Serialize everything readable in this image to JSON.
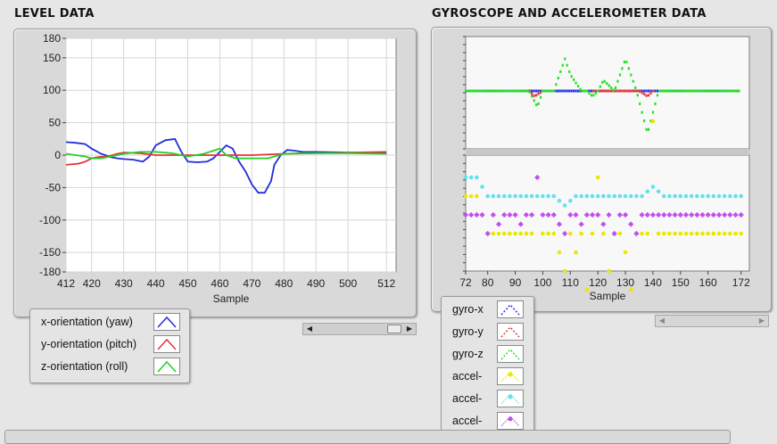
{
  "titles": {
    "level": "LEVEL DATA",
    "gyro": "GYROSCOPE AND ACCELEROMETER DATA"
  },
  "chart_data": [
    {
      "type": "line",
      "xlabel": "Sample",
      "xlim": [
        412,
        515
      ],
      "ylim": [
        -180,
        180
      ],
      "xticks": [
        412,
        420,
        430,
        440,
        450,
        460,
        470,
        480,
        490,
        500,
        512
      ],
      "yticks": [
        180,
        150,
        100,
        50,
        0,
        -50,
        -100,
        -150,
        -180
      ],
      "grid": true,
      "series": [
        {
          "name": "x-orientation (yaw)",
          "color": "#1f2fd9",
          "x": [
            412,
            415,
            418,
            420,
            423,
            426,
            428,
            430,
            433,
            436,
            438,
            440,
            443,
            446,
            448,
            450,
            453,
            456,
            458,
            460,
            462,
            464,
            466,
            468,
            470,
            472,
            474,
            476,
            477,
            479,
            481,
            483,
            486,
            490,
            500,
            512
          ],
          "y": [
            20,
            19,
            17,
            10,
            2,
            -3,
            -5,
            -6,
            -7,
            -10,
            -2,
            15,
            23,
            25,
            5,
            -10,
            -11,
            -10,
            -5,
            5,
            15,
            10,
            -10,
            -25,
            -45,
            -58,
            -58,
            -40,
            -15,
            0,
            8,
            7,
            5,
            5,
            4,
            3
          ]
        },
        {
          "name": "y-orientation (pitch)",
          "color": "#e8323a",
          "x": [
            412,
            416,
            418,
            420,
            422,
            425,
            428,
            430,
            435,
            440,
            450,
            460,
            470,
            480,
            490,
            500,
            512
          ],
          "y": [
            -15,
            -13,
            -10,
            -5,
            -3,
            -2,
            2,
            4,
            3,
            0,
            0,
            0,
            0,
            2,
            3,
            4,
            5
          ]
        },
        {
          "name": "z-orientation (roll)",
          "color": "#22d022",
          "x": [
            412,
            415,
            418,
            420,
            423,
            426,
            428,
            430,
            435,
            440,
            445,
            450,
            455,
            460,
            462,
            465,
            470,
            475,
            480,
            485,
            490,
            500,
            512
          ],
          "y": [
            2,
            0,
            -2,
            -5,
            -5,
            -2,
            0,
            2,
            5,
            5,
            3,
            -2,
            2,
            10,
            0,
            -5,
            -5,
            -5,
            2,
            3,
            3,
            3,
            2
          ]
        }
      ],
      "legend": [
        {
          "label": "x-orientation (yaw)",
          "color": "#1f2fd9"
        },
        {
          "label": "y-orientation (pitch)",
          "color": "#e8323a"
        },
        {
          "label": "z-orientation (roll)",
          "color": "#22d022"
        }
      ]
    },
    {
      "type": "scatter",
      "xlabel": "Sample",
      "xlim": [
        72,
        175
      ],
      "xticks": [
        72,
        80,
        90,
        100,
        110,
        120,
        130,
        140,
        150,
        160,
        172
      ],
      "grid": true,
      "top_series": [
        {
          "name": "gyro-x",
          "color": "#2233dd",
          "x": [
            72,
            172
          ],
          "y": [
            0,
            0
          ]
        },
        {
          "name": "gyro-y",
          "color": "#e23a3a",
          "x": [
            72,
            95,
            97,
            100,
            110,
            115,
            120,
            125,
            130,
            135,
            138,
            140,
            172
          ],
          "y": [
            0,
            0,
            -1,
            0,
            0,
            0,
            0,
            0,
            0,
            0,
            -1,
            0,
            0
          ]
        },
        {
          "name": "gyro-z",
          "color": "#22e022",
          "x": [
            72,
            95,
            97,
            98,
            100,
            104,
            106,
            108,
            110,
            114,
            116,
            118,
            120,
            122,
            124,
            126,
            128,
            130,
            132,
            134,
            136,
            138,
            140,
            142,
            172
          ],
          "y": [
            0,
            0,
            -2,
            -3,
            0,
            0,
            3,
            6,
            3,
            0,
            0,
            -1,
            0,
            2,
            1,
            0,
            3,
            6,
            3,
            0,
            -4,
            -8,
            -4,
            0,
            0
          ]
        }
      ],
      "bottom_series": [
        {
          "name": "accel-x",
          "color": "#e8e800",
          "x": [
            72,
            76,
            78,
            80,
            82,
            84,
            86,
            88,
            90,
            92,
            94,
            96,
            98,
            100,
            104,
            108,
            110,
            112,
            114,
            116,
            118,
            120,
            122,
            124,
            126,
            128,
            130,
            132,
            134,
            136,
            138,
            140,
            142,
            144,
            172
          ],
          "y": [
            1,
            1,
            0,
            -1,
            -1,
            -1,
            -1,
            -1,
            -1,
            -1,
            -1,
            -1,
            2,
            -1,
            -1,
            -3,
            -1,
            -2,
            -1,
            -4,
            -1,
            2,
            -1,
            -3,
            -1,
            -1,
            -2,
            -4,
            -1,
            -1,
            -1,
            5,
            -1,
            -1,
            -1
          ]
        },
        {
          "name": "accel-y",
          "color": "#66e0ee",
          "x": [
            72,
            76,
            78,
            80,
            82,
            84,
            86,
            88,
            90,
            92,
            94,
            96,
            98,
            100,
            104,
            108,
            112,
            116,
            120,
            124,
            128,
            132,
            136,
            140,
            144,
            172
          ],
          "y": [
            2,
            2,
            1.5,
            1,
            1,
            1,
            1,
            1,
            1,
            1,
            1,
            1,
            1,
            1,
            1,
            0.5,
            1,
            1,
            1,
            1,
            1,
            1,
            1,
            1.5,
            1,
            1
          ]
        },
        {
          "name": "accel-z",
          "color": "#c050ee",
          "x": [
            72,
            76,
            78,
            80,
            82,
            84,
            86,
            88,
            90,
            92,
            94,
            96,
            98,
            100,
            104,
            108,
            110,
            112,
            114,
            116,
            118,
            120,
            122,
            124,
            126,
            128,
            130,
            132,
            134,
            136,
            138,
            140,
            144,
            172
          ],
          "y": [
            0,
            0,
            0,
            -1,
            0,
            -0.5,
            0,
            0,
            0,
            -0.5,
            0,
            0,
            2,
            0,
            0,
            -1,
            0,
            0,
            -0.5,
            0,
            0,
            0,
            -0.5,
            0,
            -1,
            0,
            0,
            -0.5,
            -1,
            0,
            0,
            0,
            0,
            0
          ]
        }
      ],
      "legend": [
        {
          "label": "gyro-x",
          "color": "#2233dd"
        },
        {
          "label": "gyro-y",
          "color": "#e23a3a"
        },
        {
          "label": "gyro-z",
          "color": "#22e022"
        },
        {
          "label": "accel-",
          "color": "#e8e800"
        },
        {
          "label": "accel-",
          "color": "#66e0ee"
        },
        {
          "label": "accel-",
          "color": "#c050ee"
        }
      ]
    }
  ]
}
